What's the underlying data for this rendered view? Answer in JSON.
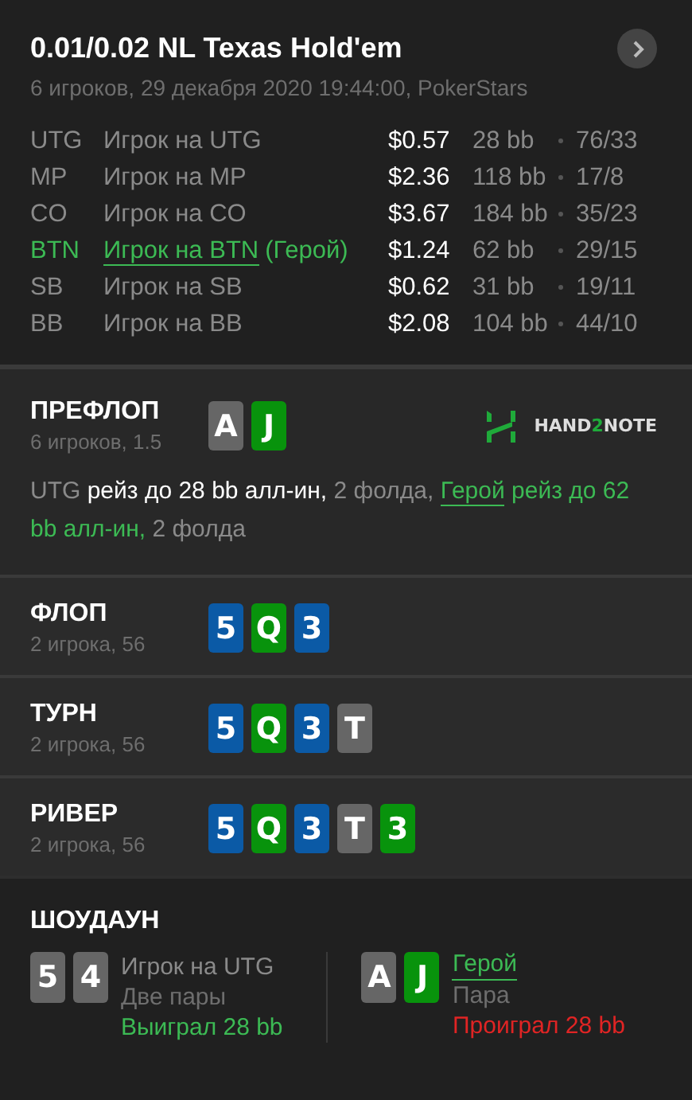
{
  "header": {
    "title": "0.01/0.02 NL Texas Hold'em",
    "subtitle": "6 игроков, 29 декабря 2020 19:44:00, PokerStars"
  },
  "players": [
    {
      "position": "UTG",
      "name": "Игрок на UTG",
      "hero": false,
      "stack": "$0.57",
      "bb": "28 bb",
      "stats": "76/33"
    },
    {
      "position": "MP",
      "name": "Игрок на MP",
      "hero": false,
      "stack": "$2.36",
      "bb": "118 bb",
      "stats": "17/8"
    },
    {
      "position": "CO",
      "name": "Игрок на CO",
      "hero": false,
      "stack": "$3.67",
      "bb": "184 bb",
      "stats": "35/23"
    },
    {
      "position": "BTN",
      "name": "Игрок на BTN",
      "hero": true,
      "hero_label": "(Герой)",
      "stack": "$1.24",
      "bb": "62 bb",
      "stats": "29/15"
    },
    {
      "position": "SB",
      "name": "Игрок на SB",
      "hero": false,
      "stack": "$0.62",
      "bb": "31 bb",
      "stats": "19/11"
    },
    {
      "position": "BB",
      "name": "Игрок на BB",
      "hero": false,
      "stack": "$2.08",
      "bb": "104 bb",
      "stats": "44/10"
    }
  ],
  "streets": [
    {
      "name": "ПРЕФЛОП",
      "info": "6 игроков, 1.5",
      "cards": [
        {
          "rank": "A",
          "color": "#666666"
        },
        {
          "rank": "J",
          "color": "#08930c"
        }
      ],
      "logo": {
        "before": "HAND",
        "accent": "2",
        "after": "NOTE"
      },
      "actions": [
        {
          "kind": "actor",
          "text": "UTG"
        },
        {
          "kind": "action",
          "text": "рейз до 28 bb алл-ин,"
        },
        {
          "kind": "fold",
          "text": "2 фолда,"
        },
        {
          "kind": "hero-link",
          "text": "Герой"
        },
        {
          "kind": "hero-action",
          "text": "рейз до 62 bb алл-ин,"
        },
        {
          "kind": "fold",
          "text": "2 фолда"
        }
      ]
    },
    {
      "name": "ФЛОП",
      "info": "2 игрока, 56",
      "cards": [
        {
          "rank": "5",
          "color": "#0b5aa6"
        },
        {
          "rank": "Q",
          "color": "#08930c"
        },
        {
          "rank": "3",
          "color": "#0b5aa6"
        }
      ]
    },
    {
      "name": "ТУРН",
      "info": "2 игрока, 56",
      "cards": [
        {
          "rank": "5",
          "color": "#0b5aa6"
        },
        {
          "rank": "Q",
          "color": "#08930c"
        },
        {
          "rank": "3",
          "color": "#0b5aa6"
        },
        {
          "rank": "T",
          "color": "#666666"
        }
      ]
    },
    {
      "name": "РИВЕР",
      "info": "2 игрока, 56",
      "cards": [
        {
          "rank": "5",
          "color": "#0b5aa6"
        },
        {
          "rank": "Q",
          "color": "#08930c"
        },
        {
          "rank": "3",
          "color": "#0b5aa6"
        },
        {
          "rank": "T",
          "color": "#666666"
        },
        {
          "rank": "3",
          "color": "#08930c"
        }
      ]
    }
  ],
  "showdown": {
    "title": "ШОУДАУН",
    "hands": [
      {
        "cards": [
          {
            "rank": "5",
            "color": "#666666"
          },
          {
            "rank": "4",
            "color": "#666666"
          }
        ],
        "name": "Игрок на UTG",
        "hero": false,
        "hand": "Две пары",
        "result": "Выиграл 28 bb",
        "won": true
      },
      {
        "cards": [
          {
            "rank": "A",
            "color": "#666666"
          },
          {
            "rank": "J",
            "color": "#08930c"
          }
        ],
        "name": "Герой",
        "hero": true,
        "hand": "Пара",
        "result": "Проиграл 28 bb",
        "won": false
      }
    ]
  }
}
